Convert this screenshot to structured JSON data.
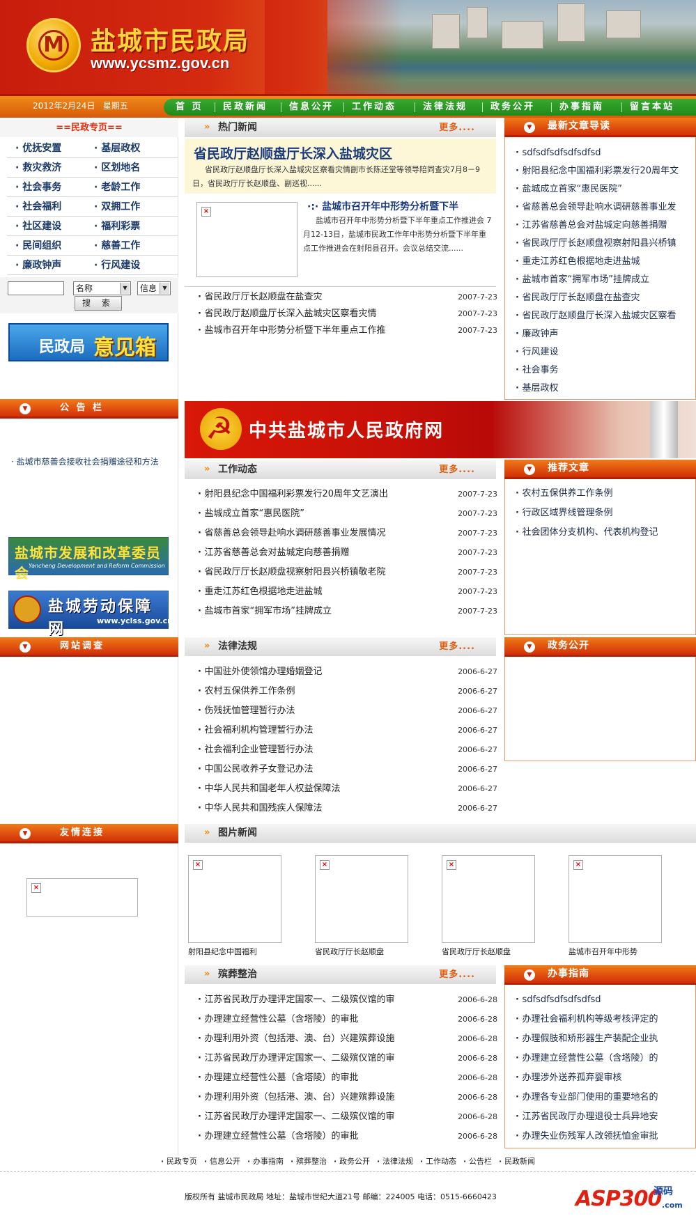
{
  "header": {
    "site_name": "盐城市民政局",
    "site_url": "www.ycsmz.gov.cn",
    "date": "2012年2月24日",
    "weekday": "星期五"
  },
  "nav": [
    "首 页",
    "民政新闻",
    "信息公开",
    "工作动态",
    "法律法规",
    "政务公开",
    "办事指南",
    "留言本站"
  ],
  "left": {
    "special_title": "==民政专页==",
    "categories": [
      [
        "优抚安置",
        "基层政权"
      ],
      [
        "救灾救济",
        "区划地名"
      ],
      [
        "社会事务",
        "老龄工作"
      ],
      [
        "社会福利",
        "双拥工作"
      ],
      [
        "社区建设",
        "福利彩票"
      ],
      [
        "民间组织",
        "慈善工作"
      ],
      [
        "廉政钟声",
        "行风建设"
      ]
    ],
    "search": {
      "field": "名称",
      "type": "信息",
      "button": "搜 索"
    },
    "suggest_box": {
      "part1": "民政局",
      "part2": "意见箱"
    },
    "notice_title": "公 告 栏",
    "notice_item": "盐城市慈善会接收社会捐赠途径和方法",
    "link_banner1": {
      "title": "盐城市发展和改革委员会",
      "subtitle": "Yancheng Development and Reform Commission"
    },
    "link_banner2": {
      "title": "盐城劳动保障网",
      "url": "www.yclss.gov.cn"
    },
    "survey_title": "网站调查",
    "friends_title": "友情连接"
  },
  "hot_news": {
    "title": "热门新闻",
    "more": "更多....",
    "headline": "省民政厅赵顺盘厅长深入盐城灾区",
    "headline_summary": "省民政厅赵顺盘厅长深入盐城灾区察看灾情副市长陈还堂等领导陪同查灾7月8－9日，省民政厅厅长赵顺盘、副巡视......",
    "second_title": "盐城市召开年中形势分析暨下半",
    "second_summary": "盐城市召开年中形势分析暨下半年重点工作推进会 7月12-13日，盐城市民政工作年中形势分析暨下半年重点工作推进会在射阳县召开。会议总结交流......",
    "list": [
      {
        "title": "省民政厅厅长赵顺盘在盐查灾",
        "date": "2007-7-23"
      },
      {
        "title": "省民政厅赵顺盘厅长深入盐城灾区察看灾情",
        "date": "2007-7-23"
      },
      {
        "title": "盐城市召开年中形势分析暨下半年重点工作推",
        "date": "2007-7-23"
      }
    ]
  },
  "right_latest": {
    "title": "最新文章导读",
    "items": [
      "sdfsdfsdfsdfsdfsd",
      "射阳县纪念中国福利彩票发行20周年文",
      "盐城成立首家“惠民医院”",
      "省慈善总会领导赴响水调研慈善事业发",
      "江苏省慈善总会对盐城定向慈善捐赠",
      "省民政厅厅长赵顺盘视察射阳县兴桥镇",
      "重走江苏红色根据地走进盐城",
      "盐城市首家“拥军市场”挂牌成立",
      "省民政厅厅长赵顺盘在盐查灾",
      "省民政厅赵顺盘厅长深入盐城灾区察看",
      "廉政钟声",
      "行风建设",
      "社会事务",
      "基层政权"
    ]
  },
  "party_banner": "中共盐城市人民政府网",
  "work_news": {
    "title": "工作动态",
    "more": "更多....",
    "list": [
      {
        "title": "射阳县纪念中国福利彩票发行20周年文艺演出",
        "date": "2007-7-23"
      },
      {
        "title": "盐城成立首家“惠民医院”",
        "date": "2007-7-23"
      },
      {
        "title": "省慈善总会领导赴响水调研慈善事业发展情况",
        "date": "2007-7-23"
      },
      {
        "title": "江苏省慈善总会对盐城定向慈善捐赠",
        "date": "2007-7-23"
      },
      {
        "title": "省民政厅厅长赵顺盘视察射阳县兴桥镇敬老院",
        "date": "2007-7-23"
      },
      {
        "title": "重走江苏红色根据地走进盐城",
        "date": "2007-7-23"
      },
      {
        "title": "盐城市首家“拥军市场”挂牌成立",
        "date": "2007-7-23"
      }
    ]
  },
  "recommend": {
    "title": "推荐文章",
    "items": [
      "农村五保供养工作条例",
      "行政区域界线管理条例",
      "社会团体分支机构、代表机构登记"
    ]
  },
  "laws": {
    "title": "法律法规",
    "more": "更多....",
    "list": [
      {
        "title": "中国驻外使领馆办理婚姻登记",
        "date": "2006-6-27"
      },
      {
        "title": "农村五保供养工作条例",
        "date": "2006-6-27"
      },
      {
        "title": "伤残抚恤管理暂行办法",
        "date": "2006-6-27"
      },
      {
        "title": "社会福利机构管理暂行办法",
        "date": "2006-6-27"
      },
      {
        "title": "社会福利企业管理暂行办法",
        "date": "2006-6-27"
      },
      {
        "title": "中国公民收养子女登记办法",
        "date": "2006-6-27"
      },
      {
        "title": "中华人民共和国老年人权益保障法",
        "date": "2006-6-27"
      },
      {
        "title": "中华人民共和国残疾人保障法",
        "date": "2006-6-27"
      }
    ]
  },
  "gov_affairs": {
    "title": "政务公开"
  },
  "photo_news": {
    "title": "图片新闻",
    "captions": [
      "射阳县纪念中国福利",
      "省民政厅厅长赵顺盘",
      "省民政厅厅长赵顺盘",
      "盐城市召开年中形势"
    ]
  },
  "funeral": {
    "title": "殡葬整治",
    "more": "更多....",
    "list": [
      {
        "title": "江苏省民政厅办理评定国家一、二级殡仪馆的审",
        "date": "2006-6-28"
      },
      {
        "title": "办理建立经营性公墓（含塔陵）的审批",
        "date": "2006-6-28"
      },
      {
        "title": "办理利用外资（包括港、澳、台）兴建殡葬设施",
        "date": "2006-6-28"
      },
      {
        "title": "江苏省民政厅办理评定国家一、二级殡仪馆的审",
        "date": "2006-6-28"
      },
      {
        "title": "办理建立经营性公墓（含塔陵）的审批",
        "date": "2006-6-28"
      },
      {
        "title": "办理利用外资（包括港、澳、台）兴建殡葬设施",
        "date": "2006-6-28"
      },
      {
        "title": "江苏省民政厅办理评定国家一、二级殡仪馆的审",
        "date": "2006-6-28"
      },
      {
        "title": "办理建立经营性公墓（含塔陵）的审批",
        "date": "2006-6-28"
      }
    ]
  },
  "guide": {
    "title": "办事指南",
    "items": [
      "sdfsdfsdfsdfsdfsd",
      "办理社会福利机构等级考核评定的",
      "办理假肢和矫形器生产装配企业执",
      "办理建立经营性公墓（含塔陵）的",
      "办理涉外送养孤弃婴审核",
      "办理各专业部门使用的重要地名的",
      "江苏省民政厅办理退役士兵异地安",
      "办理失业伤残军人改领抚恤金审批"
    ]
  },
  "footer": {
    "links": [
      "民政专页",
      "信息公开",
      "办事指南",
      "殡葬整治",
      "政务公开",
      "法律法规",
      "工作动态",
      "公告栏",
      "民政新闻"
    ],
    "copyright": "版权所有  盐城市民政局  地址：盐城市世纪大道21号  邮编：224005  电话：0515-6660423",
    "watermark": {
      "brand": "ASP300",
      "tag": "源码",
      "domain": ".com"
    }
  },
  "colors": {
    "accent": "#d23008",
    "nav_green": "#1f8a1a",
    "link_blue": "#1a3a6a",
    "more": "#e06010"
  }
}
